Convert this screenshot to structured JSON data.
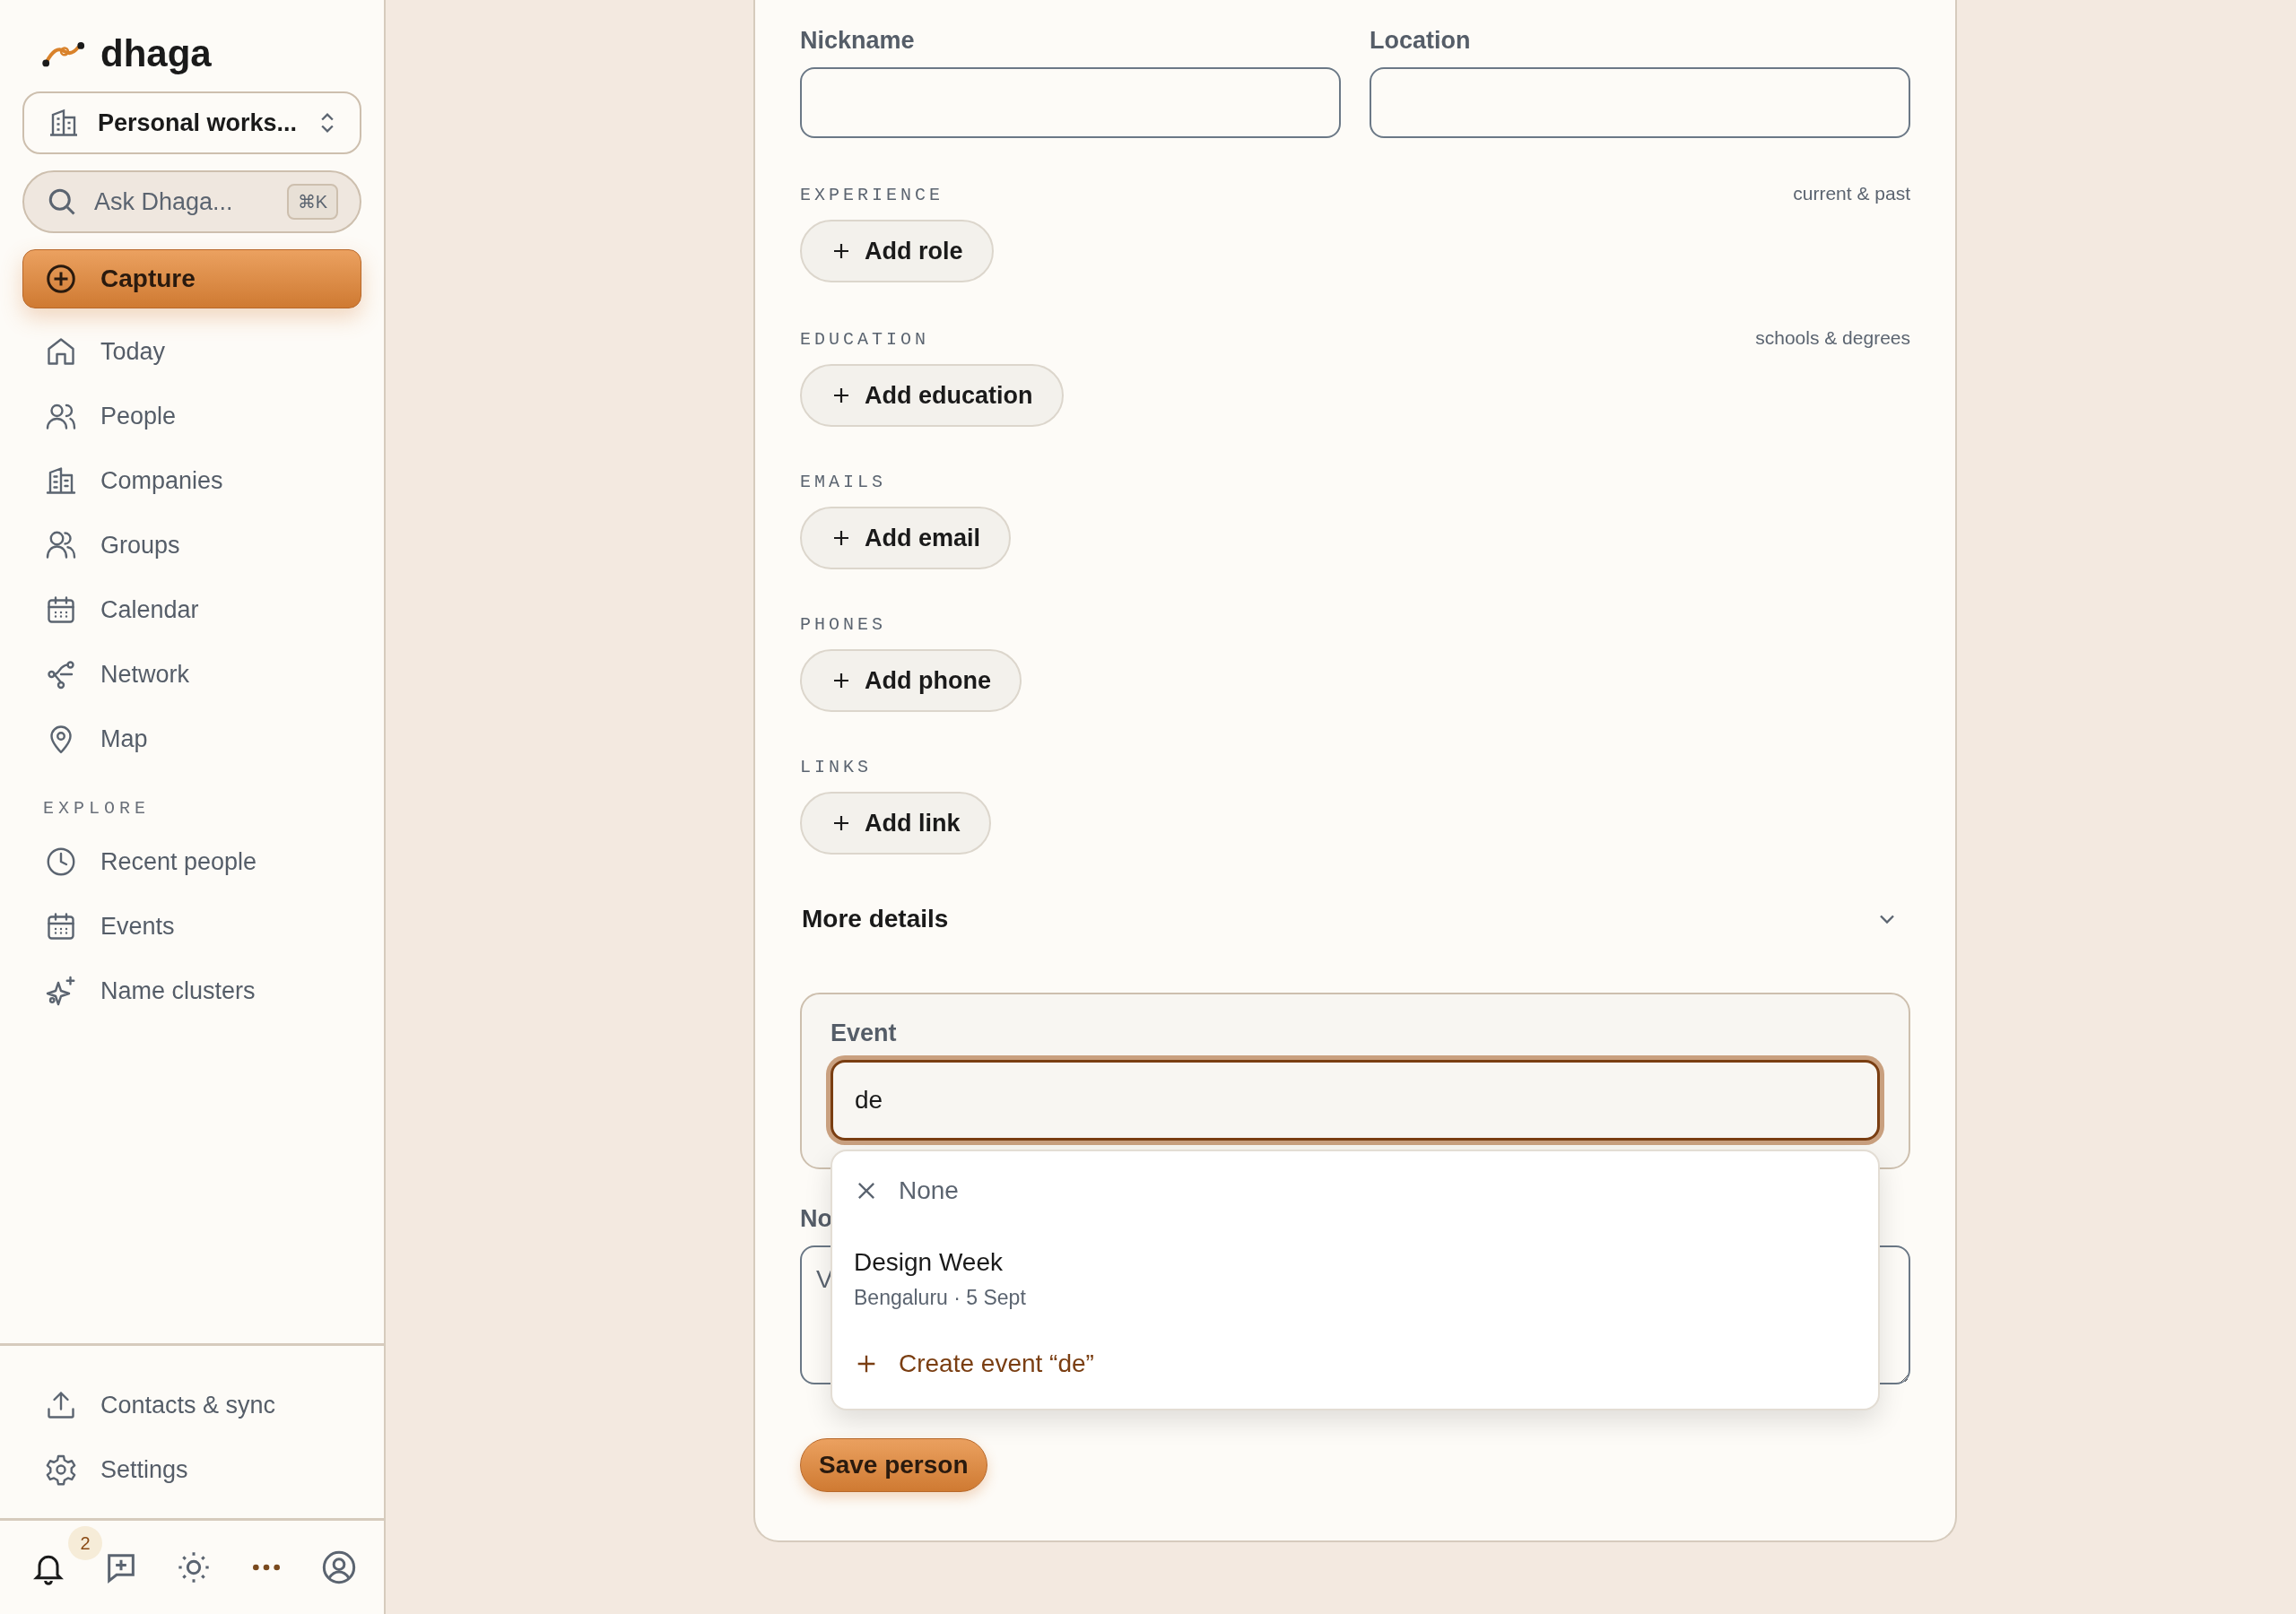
{
  "sidebar": {
    "brand": "dhaga",
    "workspace": "Personal works...",
    "search": {
      "placeholder": "Ask Dhaga...",
      "shortcut": "⌘K"
    },
    "capture": "Capture",
    "nav": [
      {
        "label": "Today"
      },
      {
        "label": "People"
      },
      {
        "label": "Companies"
      },
      {
        "label": "Groups"
      },
      {
        "label": "Calendar"
      },
      {
        "label": "Network"
      },
      {
        "label": "Map"
      }
    ],
    "explore_label": "EXPLORE",
    "explore": [
      {
        "label": "Recent people"
      },
      {
        "label": "Events"
      },
      {
        "label": "Name clusters"
      }
    ],
    "footer_links": [
      {
        "label": "Contacts & sync"
      },
      {
        "label": "Settings"
      }
    ],
    "notification_count": "2"
  },
  "form": {
    "fields": [
      {
        "label": "Nickname"
      },
      {
        "label": "Location"
      }
    ],
    "sections": [
      {
        "title": "EXPERIENCE",
        "hint": "current & past",
        "button": "Add role"
      },
      {
        "title": "EDUCATION",
        "hint": "schools & degrees",
        "button": "Add education"
      },
      {
        "title": "EMAILS",
        "button": "Add email"
      },
      {
        "title": "PHONES",
        "button": "Add phone"
      },
      {
        "title": "LINKS",
        "button": "Add link"
      }
    ],
    "more_details": "More details",
    "event": {
      "label": "Event",
      "value": "de",
      "options": [
        {
          "kind": "clear",
          "label": "None"
        },
        {
          "kind": "event",
          "label": "Design Week",
          "detail": "Bengaluru · 5 Sept"
        },
        {
          "kind": "create",
          "label": "Create event “de”"
        }
      ]
    },
    "notes": {
      "label": "No",
      "placeholder": "V"
    },
    "save": "Save person"
  }
}
